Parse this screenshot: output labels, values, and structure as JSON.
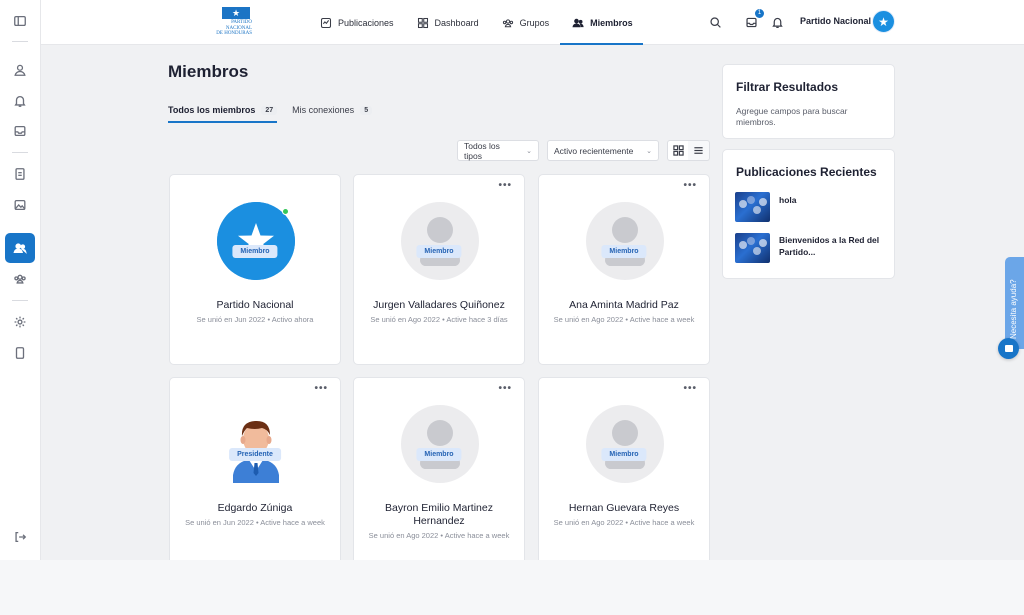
{
  "header": {
    "logo_line1": "PARTIDO",
    "logo_line2": "NACIONAL",
    "logo_line3": "DE HONDURAS",
    "nav": [
      {
        "label": "Publicaciones",
        "icon": "activity-icon"
      },
      {
        "label": "Dashboard",
        "icon": "grid-icon"
      },
      {
        "label": "Grupos",
        "icon": "groups-icon"
      },
      {
        "label": "Miembros",
        "icon": "members-icon",
        "active": true
      }
    ],
    "messages_badge": "1",
    "user_name": "Partido Nacional"
  },
  "main": {
    "title": "Miembros",
    "tabs": [
      {
        "label": "Todos los miembros",
        "count": "27",
        "active": true
      },
      {
        "label": "Mis conexiones",
        "count": "5"
      }
    ],
    "filters": {
      "type_select": "Todos los tipos",
      "sort_select": "Activo recientemente"
    },
    "more_label": "•••",
    "members": [
      {
        "name": "Partido Nacional",
        "role": "Miembro",
        "meta": "Se unió en Jun 2022 • Activo ahora",
        "avatar": "brand-star",
        "online": true
      },
      {
        "name": "Jurgen Valladares Quiñonez",
        "role": "Miembro",
        "meta": "Se unió en Ago 2022 • Active hace 3 días",
        "avatar": "placeholder"
      },
      {
        "name": "Ana Aminta Madrid Paz",
        "role": "Miembro",
        "meta": "Se unió en Ago 2022 • Active hace a week",
        "avatar": "placeholder"
      },
      {
        "name": "Edgardo Zúniga",
        "role": "Presidente",
        "meta": "Se unió en Jun 2022 • Active hace a week",
        "avatar": "person-illustration"
      },
      {
        "name": "Bayron Emilio Martinez Hernandez",
        "role": "Miembro",
        "meta": "Se unió en Ago 2022 • Active hace a week",
        "avatar": "placeholder"
      },
      {
        "name": "Hernan Guevara Reyes",
        "role": "Miembro",
        "meta": "Se unió en Ago 2022 • Active hace a week",
        "avatar": "placeholder"
      }
    ]
  },
  "sidebar": {
    "filter_title": "Filtrar Resultados",
    "filter_desc": "Agregue campos para buscar miembros.",
    "recent_title": "Publicaciones Recientes",
    "recent_posts": [
      {
        "title": "hola"
      },
      {
        "title": "Bienvenidos a la Red del Partido..."
      }
    ]
  },
  "help": {
    "label": "Necesita ayuda?"
  },
  "colors": {
    "accent": "#1875c8",
    "role_badge_bg": "#dbe8fb",
    "online": "#36c65a"
  }
}
